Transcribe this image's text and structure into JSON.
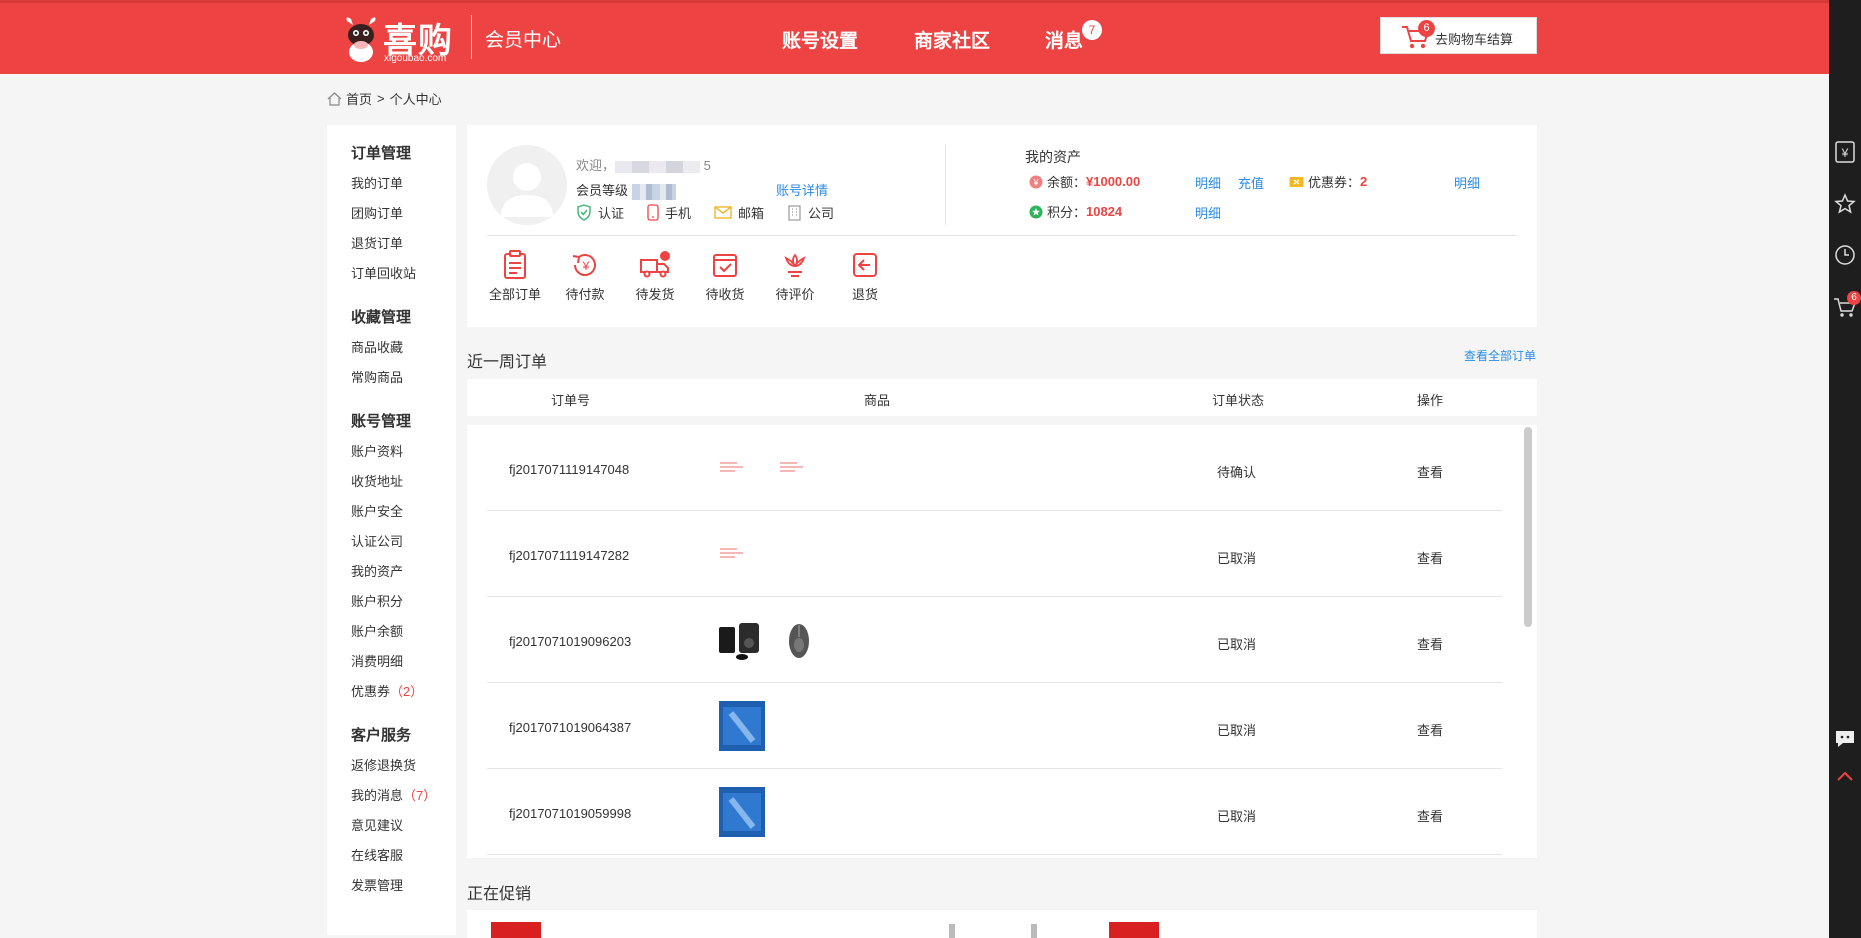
{
  "header": {
    "brand": "喜购",
    "domain": "xigoubao.com",
    "section": "会员中心",
    "nav": [
      "账号设置",
      "商家社区",
      "消息"
    ],
    "messages_badge": "7",
    "cart_count": "6",
    "cart_label": "去购物车结算"
  },
  "breadcrumb": {
    "home": "首页",
    "sep": ">",
    "current": "个人中心"
  },
  "sidebar": {
    "groups": [
      {
        "title": "订单管理",
        "items": [
          "我的订单",
          "团购订单",
          "退货订单",
          "订单回收站"
        ]
      },
      {
        "title": "收藏管理",
        "items": [
          "商品收藏",
          "常购商品"
        ]
      },
      {
        "title": "账号管理",
        "items": [
          "账户资料",
          "收货地址",
          "账户安全",
          "认证公司",
          "我的资产",
          "账户积分",
          "账户余额",
          "消费明细",
          "优惠券"
        ]
      },
      {
        "title": "客户服务",
        "items": [
          "返修退换货",
          "我的消息",
          "意见建议",
          "在线客服",
          "发票管理"
        ]
      }
    ],
    "coupon_count": "（2）",
    "message_count": "（7）"
  },
  "profile": {
    "welcome": "欢迎，",
    "welcome_tail": "5",
    "level_label": "会员等级",
    "account_detail": "账号详情",
    "verify": [
      "认证",
      "手机",
      "邮箱",
      "公司"
    ]
  },
  "assets": {
    "title": "我的资产",
    "balance_label": "余额：",
    "balance_value": "¥1000.00",
    "points_label": "积分：",
    "points_value": "10824",
    "coupon_label": "优惠券：",
    "coupon_value": "2",
    "detail": "明细",
    "recharge": "充值"
  },
  "order_quick": [
    "全部订单",
    "待付款",
    "待发货",
    "待收货",
    "待评价",
    "退货"
  ],
  "recent": {
    "title": "近一周订单",
    "view_all": "查看全部订单",
    "columns": [
      "订单号",
      "商品",
      "订单状态",
      "操作"
    ],
    "rows": [
      {
        "id": "fj2017071119147048",
        "status": "待确认",
        "op": "查看"
      },
      {
        "id": "fj2017071119147282",
        "status": "已取消",
        "op": "查看"
      },
      {
        "id": "fj2017071019096203",
        "status": "已取消",
        "op": "查看"
      },
      {
        "id": "fj2017071019064387",
        "status": "已取消",
        "op": "查看"
      },
      {
        "id": "fj2017071019059998",
        "status": "已取消",
        "op": "查看"
      }
    ]
  },
  "promo": {
    "title": "正在促销"
  },
  "rail": {
    "cart_count": "6"
  },
  "colors": {
    "brand_red": "#ee4343",
    "link_blue": "#2b8ce6"
  }
}
